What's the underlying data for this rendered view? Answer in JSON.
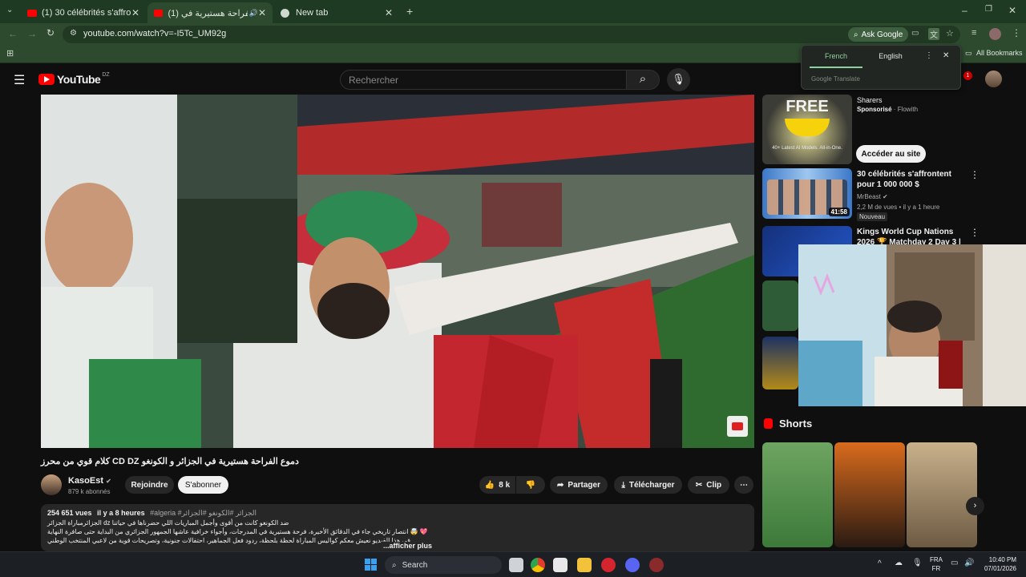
{
  "browser": {
    "tabs": [
      {
        "label": "(1) 30 célébrités s'affrontent po"
      },
      {
        "label": "(1) دموع الفراحة هستيرية في"
      },
      {
        "label": "New tab"
      }
    ],
    "url": "youtube.com/watch?v=-I5Tc_UM92g",
    "ask_google": "Ask Google",
    "all_bookmarks": "All Bookmarks"
  },
  "translate": {
    "lang1": "French",
    "lang2": "English",
    "brand": "Google Translate"
  },
  "youtube": {
    "logo": "YouTube",
    "region": "DZ",
    "search_placeholder": "Rechercher",
    "notif_count": "1"
  },
  "video": {
    "title": "كلام قوي من محرز CD DZ دموع الفراحة هستيرية في الجزائر و الكونغو",
    "channel": "KasoEst",
    "subscribers": "879 k abonnés",
    "join": "Rejoindre",
    "subscribe": "S'abonner",
    "likes": "8 k",
    "share": "Partager",
    "download": "Télécharger",
    "clip": "Clip",
    "views": "254 651 vues",
    "ago": "il y a 8 heures",
    "tags": "#algeria #الجزائر #الكونغو #الجزائر",
    "desc_line1": "الجزائرمباراة الجزائر dz ضد الكونغو كانت من أقوى وأجمل المباريات اللي حضرناها في حياتنا",
    "desc_line2": "انتصار تاريخي جاء في الدقائق الأخيرة، فرحة هستيرية في المدرجات، وأجواء خرافية عاشها الجمهور الجزائري من البداية حتى صافرة النهاية 🤯 💖",
    "desc_line3": "في هذا الفيديو نعيش معكم كواليس المباراة لحظة بلحظة، ردود فعل الجماهير، احتفالات جنونية، وتصريحات قوية من لاعبي المنتخب الوطني.",
    "more": "...afficher plus"
  },
  "sidebar": {
    "ad": {
      "title": "Sharers",
      "sponsor": "Sponsorisé",
      "advertiser": "Flowith",
      "cta": "Accéder au site",
      "thumb_text": "FREE",
      "thumb_sub": "40+ Latest AI Models. All-in-One."
    },
    "items": [
      {
        "title": "30 célébrités s'affrontent pour 1 000 000 $",
        "channel": "MrBeast",
        "meta": "2,2 M de vues • il y a 1 heure",
        "badge": "Nouveau",
        "duration": "41:58"
      },
      {
        "title": "Kings World Cup Nations 2026 🏆 Matchday 2 Day 3 |",
        "channel": "",
        "meta": "",
        "badge": "",
        "duration": ""
      }
    ],
    "shorts_label": "Shorts"
  },
  "taskbar": {
    "search": "Search",
    "lang": "FRA",
    "lang2": "FR",
    "time": "10:40 PM",
    "date": "07/01/2026"
  }
}
